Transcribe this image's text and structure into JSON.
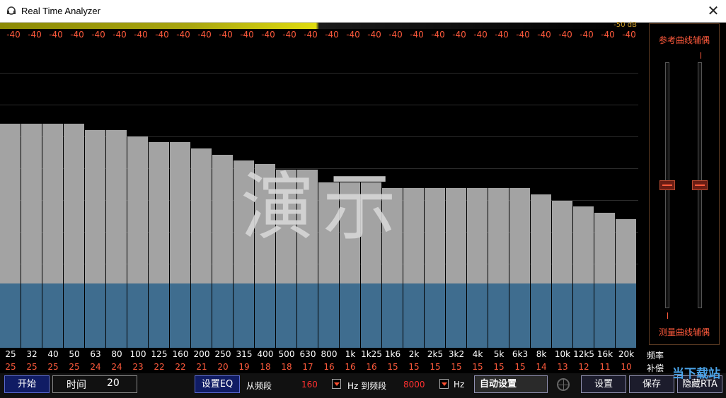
{
  "window": {
    "title": "Real Time Analyzer",
    "close_glyph": "✕"
  },
  "level_meter": {
    "label": "-50 dB",
    "fill_fraction": 0.5
  },
  "peaks": [
    "-40",
    "-40",
    "-40",
    "-40",
    "-40",
    "-40",
    "-40",
    "-40",
    "-40",
    "-40",
    "-40",
    "-40",
    "-40",
    "-40",
    "-40",
    "-40",
    "-40",
    "-40",
    "-40",
    "-40",
    "-40",
    "-40",
    "-40",
    "-40",
    "-40",
    "-40",
    "-40",
    "-40",
    "-40",
    "-40"
  ],
  "watermark": "演示",
  "chart_data": {
    "type": "bar",
    "categories": [
      "25",
      "32",
      "40",
      "50",
      "63",
      "80",
      "100",
      "125",
      "160",
      "200",
      "250",
      "315",
      "400",
      "500",
      "630",
      "800",
      "1k",
      "1k25",
      "1k6",
      "2k",
      "2k5",
      "3k2",
      "4k",
      "5k",
      "6k3",
      "8k",
      "10k",
      "12k5",
      "16k",
      "20k"
    ],
    "bar_levels": [
      0.73,
      0.73,
      0.73,
      0.73,
      0.71,
      0.71,
      0.69,
      0.67,
      0.67,
      0.65,
      0.63,
      0.61,
      0.6,
      0.58,
      0.58,
      0.54,
      0.54,
      0.54,
      0.52,
      0.52,
      0.52,
      0.52,
      0.52,
      0.52,
      0.52,
      0.5,
      0.48,
      0.46,
      0.44,
      0.42
    ],
    "baseline_level": 0.21
  },
  "frequencies": [
    "25",
    "32",
    "40",
    "50",
    "63",
    "80",
    "100",
    "125",
    "160",
    "200",
    "250",
    "315",
    "400",
    "500",
    "630",
    "800",
    "1k",
    "1k25",
    "1k6",
    "2k",
    "2k5",
    "3k2",
    "4k",
    "5k",
    "6k3",
    "8k",
    "10k",
    "12k5",
    "16k",
    "20k"
  ],
  "frequency_label": "频率",
  "gains": [
    "25",
    "25",
    "25",
    "25",
    "24",
    "24",
    "23",
    "22",
    "22",
    "21",
    "20",
    "19",
    "18",
    "18",
    "17",
    "16",
    "16",
    "16",
    "15",
    "15",
    "15",
    "15",
    "15",
    "15",
    "15",
    "14",
    "13",
    "12",
    "11",
    "10"
  ],
  "gain_label": "补偿",
  "side_panel": {
    "ref_title": "参考曲线辅偶",
    "meas_title": "测量曲线辅偶",
    "ref_level": 0.5,
    "meas_level": 0.5
  },
  "toolbar": {
    "start": "开始",
    "time_label": "时间",
    "time_value": "20",
    "set_eq": "设置EQ",
    "from_band": "从频段",
    "from_value": "160",
    "hz_to_band": "Hz 到频段",
    "to_value": "8000",
    "hz": "Hz",
    "auto_setting": "自动设置",
    "settings": "设置",
    "save": "保存",
    "hide_rta": "隐藏RTA"
  },
  "site_watermark": "当下载站",
  "colors": {
    "bar": "#a3a3a3",
    "lower": "#3f6d8f",
    "red": "#ff5a3c"
  }
}
